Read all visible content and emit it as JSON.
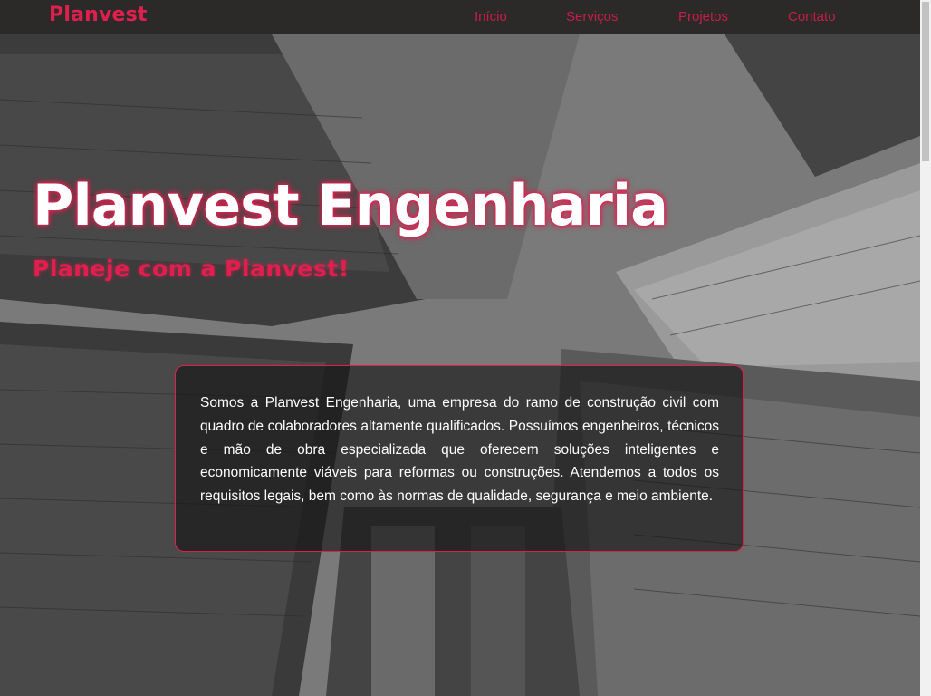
{
  "navbar": {
    "brand": "Planvest",
    "links": [
      {
        "label": "Início"
      },
      {
        "label": "Serviços"
      },
      {
        "label": "Projetos"
      },
      {
        "label": "Contato"
      }
    ]
  },
  "hero": {
    "title": "Planvest Engenharia",
    "subtitle": "Planeje com a Planvest!",
    "background": "grayscale skyscrapers viewed from below"
  },
  "about": {
    "text": "Somos a Planvest Engenharia, uma empresa do ramo de construção civil com quadro de colaboradores altamente qualificados. Possuímos engenheiros, técnicos e mão de obra especializada que oferecem soluções inteligentes e economicamente viáveis para reformas ou construções. Atendemos a todos os requisitos legais, bem como às normas de qualidade, segurança e meio ambiente."
  },
  "colors": {
    "accent": "#e01f4f",
    "navbar_bg": "#282624",
    "text": "#ffffff"
  }
}
